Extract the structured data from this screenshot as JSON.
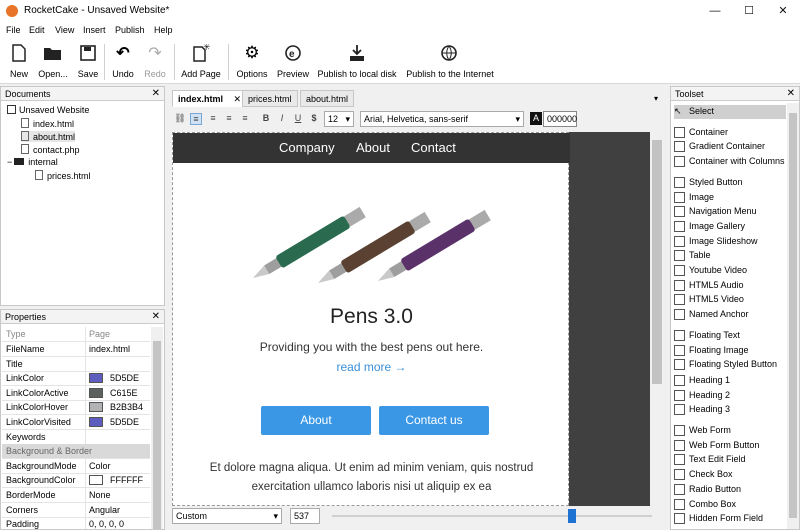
{
  "window": {
    "title": "RocketCake - Unsaved Website*"
  },
  "menu": [
    "File",
    "Edit",
    "View",
    "Insert",
    "Publish",
    "Help"
  ],
  "toolbar": {
    "new": "New",
    "open": "Open...",
    "save": "Save",
    "undo": "Undo",
    "redo": "Redo",
    "add_page": "Add Page",
    "options": "Options",
    "preview": "Preview",
    "publish_local": "Publish to local disk",
    "publish_internet": "Publish to the Internet"
  },
  "documents": {
    "title": "Documents",
    "tree": [
      {
        "label": "Unsaved Website",
        "level": 0
      },
      {
        "label": "index.html",
        "level": 1
      },
      {
        "label": "about.html",
        "level": 1,
        "selected": true
      },
      {
        "label": "contact.php",
        "level": 1
      },
      {
        "label": "internal",
        "level": 0
      },
      {
        "label": "prices.html",
        "level": 2
      }
    ]
  },
  "properties": {
    "title": "Properties",
    "header": {
      "key": "Type",
      "value": "Page"
    },
    "rows": [
      {
        "key": "FileName",
        "value": "index.html"
      },
      {
        "key": "Title",
        "value": ""
      },
      {
        "key": "LinkColor",
        "value": "5D5DE",
        "color": "#5d5dbe"
      },
      {
        "key": "LinkColorActive",
        "value": "C615E",
        "color": "#5c615e"
      },
      {
        "key": "LinkColorHover",
        "value": "B2B3B4",
        "color": "#b2b3b4"
      },
      {
        "key": "LinkColorVisited",
        "value": "5D5DE",
        "color": "#5d5dbe"
      },
      {
        "key": "Keywords",
        "value": ""
      },
      {
        "key": "Background & Border",
        "value": "",
        "section": true
      },
      {
        "key": "BackgroundMode",
        "value": "Color"
      },
      {
        "key": "BackgroundColor",
        "value": "FFFFFF",
        "color": "#ffffff"
      },
      {
        "key": "BorderMode",
        "value": "None"
      },
      {
        "key": "Corners",
        "value": "Angular"
      },
      {
        "key": "Padding",
        "value": "0, 0, 0, 0"
      }
    ]
  },
  "editor": {
    "tabs": [
      {
        "label": "index.html",
        "active": true
      },
      {
        "label": "prices.html"
      },
      {
        "label": "about.html"
      }
    ],
    "format": {
      "font_size": "12",
      "font_family": "Arial, Helvetica, sans-serif",
      "color_label": "A",
      "color_value": "000000"
    },
    "bottom": {
      "view_mode": "Custom",
      "width_value": "537"
    }
  },
  "page": {
    "nav": [
      "Company",
      "About",
      "Contact"
    ],
    "hero_title": "Pens 3.0",
    "hero_sub": "Providing you with the best pens out here.",
    "hero_link": "read more →",
    "buttons": [
      "About",
      "Contact us"
    ],
    "body_text": "Et dolore magna aliqua. Ut enim ad minim veniam, quis nostrud exercitation ullamco laboris nisi ut aliquip ex ea",
    "pen_colors": [
      "#2a6a4f",
      "#5a4132",
      "#5b3169"
    ]
  },
  "toolset": {
    "title": "Toolset",
    "items": [
      "Select",
      "Container",
      "Gradient Container",
      "Container with Columns",
      "Styled Button",
      "Image",
      "Navigation Menu",
      "Image Gallery",
      "Image Slideshow",
      "Table",
      "Youtube Video",
      "HTML5 Audio",
      "HTML5 Video",
      "Named Anchor",
      "Floating Text",
      "Floating Image",
      "Floating Styled Button",
      "Heading 1",
      "Heading 2",
      "Heading 3",
      "Web Form",
      "Web Form Button",
      "Text Edit Field",
      "Check Box",
      "Radio Button",
      "Combo Box",
      "Hidden Form Field"
    ]
  }
}
